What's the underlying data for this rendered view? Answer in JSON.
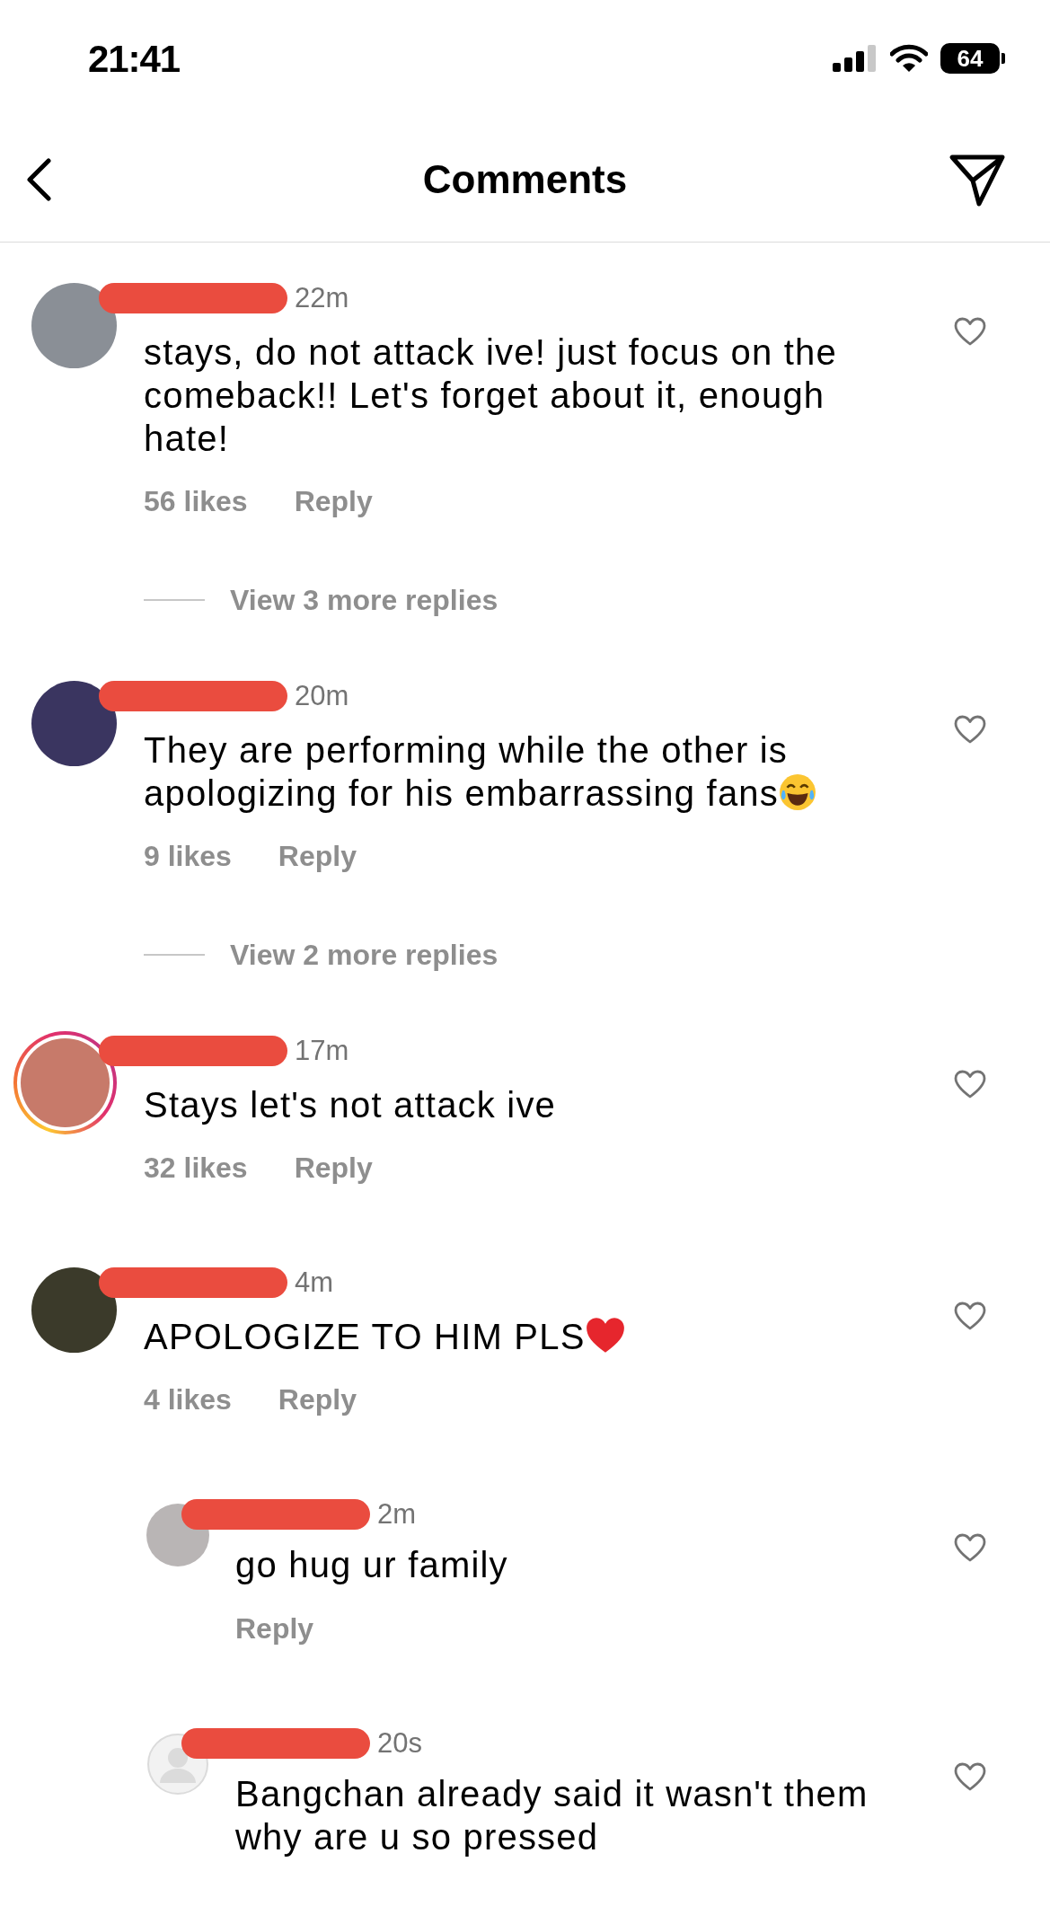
{
  "status_bar": {
    "time": "21:41",
    "battery": "64"
  },
  "header": {
    "title": "Comments"
  },
  "comments": [
    {
      "kind": "comment",
      "redacted": true,
      "avatar": {
        "kind": "photo"
      },
      "story_ring": false,
      "time": "22m",
      "text": "stays, do not attack ive! just focus on the comeback!! Let's forget about it, enough hate!",
      "likes": "56 likes",
      "reply": "Reply",
      "view_replies": "View 3 more replies"
    },
    {
      "kind": "comment",
      "redacted": true,
      "avatar": {
        "kind": "photo"
      },
      "story_ring": false,
      "time": "20m",
      "text": "They are performing while the other is apologizing for his embarrassing fans",
      "emoji": {
        "kind": "laughing-face"
      },
      "likes": "9 likes",
      "reply": "Reply",
      "view_replies": "View 2 more replies"
    },
    {
      "kind": "comment",
      "redacted": true,
      "avatar": {
        "kind": "photo"
      },
      "story_ring": true,
      "time": "17m",
      "text": "Stays let's not attack ive",
      "likes": "32 likes",
      "reply": "Reply"
    },
    {
      "kind": "comment",
      "redacted": true,
      "avatar": {
        "kind": "photo"
      },
      "story_ring": false,
      "time": "4m",
      "text": "APOLOGIZE TO HIM PLS",
      "emoji": {
        "kind": "heart"
      },
      "likes": "4 likes",
      "reply": "Reply"
    },
    {
      "kind": "reply",
      "redacted": true,
      "avatar": {
        "kind": "photo"
      },
      "story_ring": false,
      "time": "2m",
      "text": "go hug ur family",
      "reply": "Reply"
    },
    {
      "kind": "reply",
      "redacted": true,
      "avatar": {
        "kind": "default"
      },
      "story_ring": false,
      "time": "20s",
      "text": "Bangchan already said it wasn't them why are u so pressed"
    }
  ]
}
